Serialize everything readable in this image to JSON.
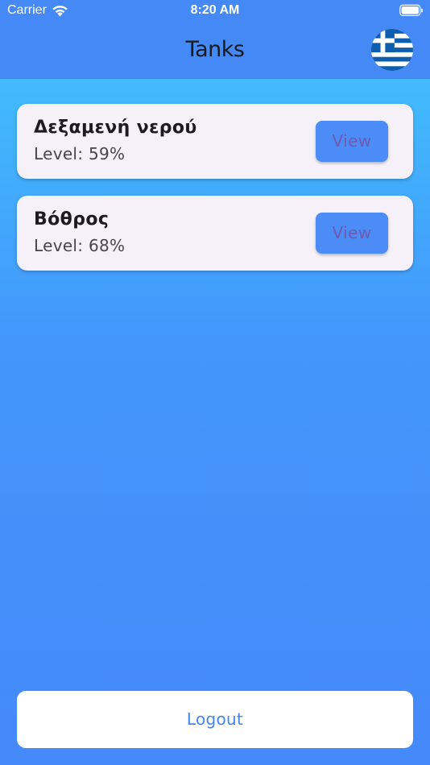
{
  "status_bar": {
    "carrier": "Carrier",
    "time": "8:20 AM",
    "wifi_icon": "wifi-icon",
    "battery_icon": "battery-icon"
  },
  "header": {
    "title": "Tanks",
    "language_flag_icon": "greece-flag-icon"
  },
  "tanks": [
    {
      "name": "Δεξαμενή νερού",
      "level_text": "Level: 59%",
      "level_percent": 59,
      "view_label": "View"
    },
    {
      "name": "Βόθρος",
      "level_text": "Level: 68%",
      "level_percent": 68,
      "view_label": "View"
    }
  ],
  "logout_label": "Logout",
  "colors": {
    "header_bg": "#4489f6",
    "gradient_top": "#41c6fd",
    "gradient_bottom": "#4589fa",
    "card_bg": "#f6f0f8",
    "view_button_bg": "#4c8cf6",
    "view_button_text": "#6e5ab0",
    "logout_text": "#4187ee",
    "flag_blue": "#0d5eaf"
  }
}
